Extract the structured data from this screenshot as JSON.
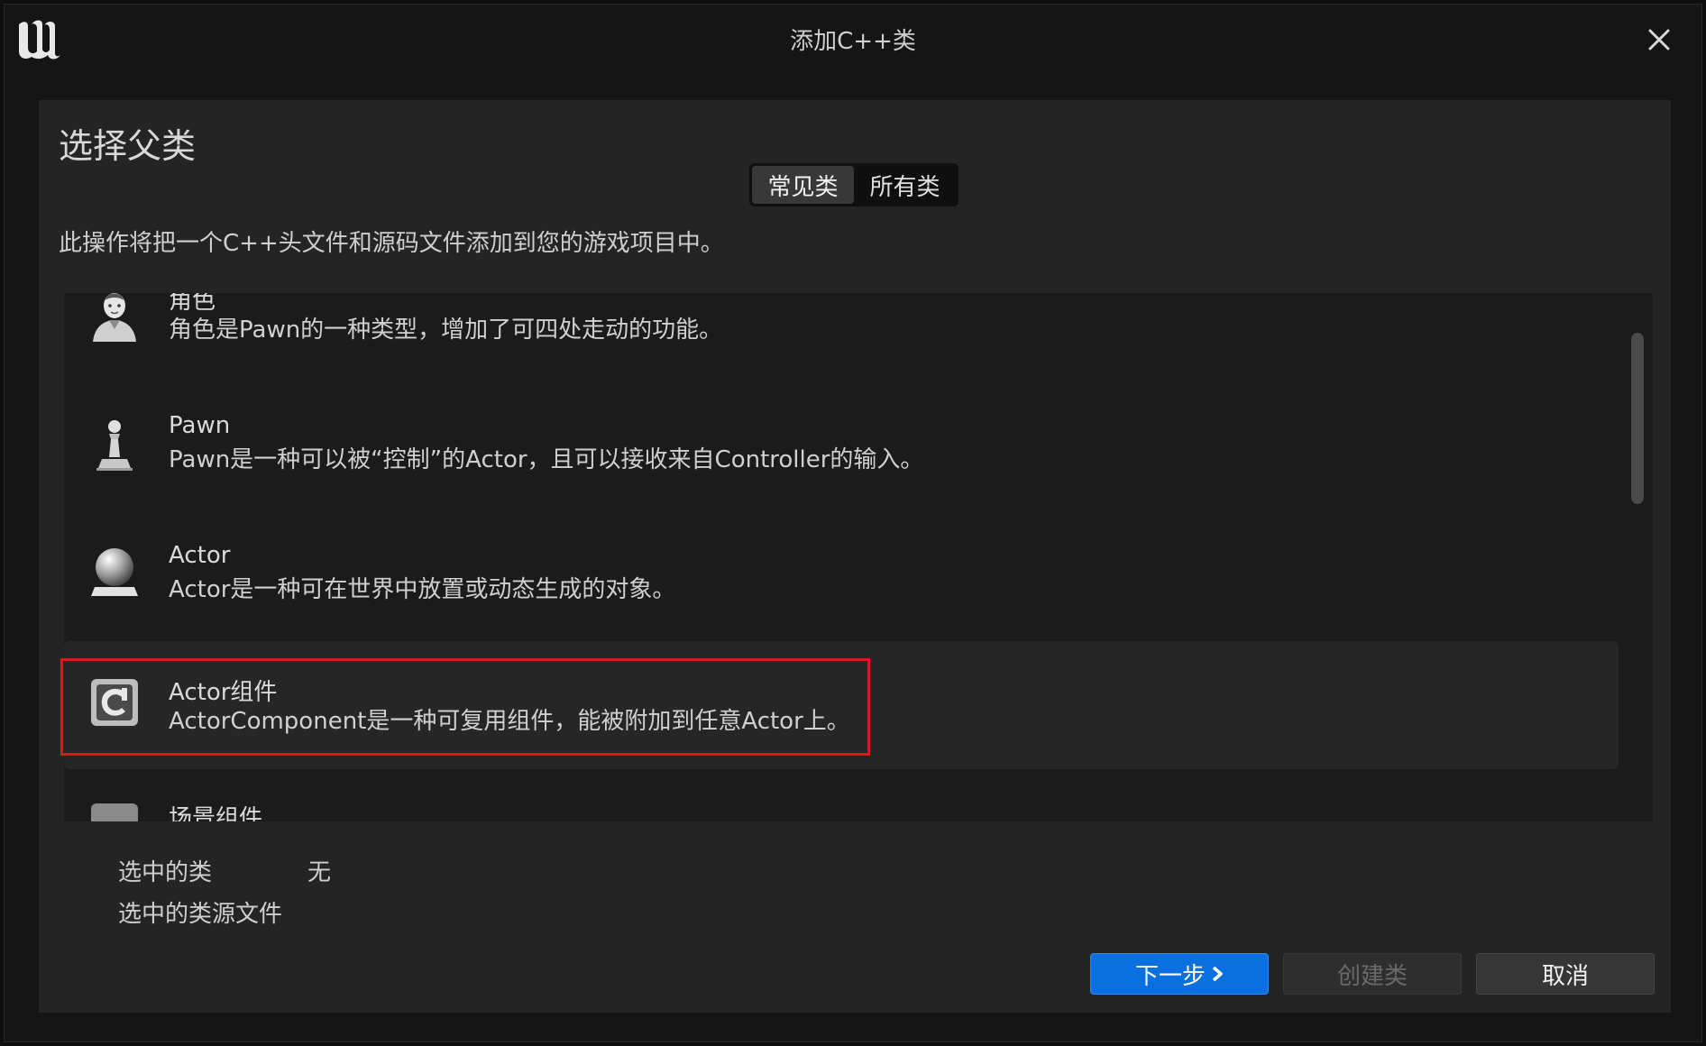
{
  "window": {
    "title": "添加C++类"
  },
  "page": {
    "heading": "选择父类",
    "description": "此操作将把一个C++头文件和源码文件添加到您的游戏项目中。"
  },
  "tabs": [
    {
      "label": "常见类",
      "active": true
    },
    {
      "label": "所有类",
      "active": false
    }
  ],
  "classes": [
    {
      "name": "角色",
      "description": "角色是Pawn的一种类型，增加了可四处走动的功能。",
      "icon": "character-icon"
    },
    {
      "name": "Pawn",
      "description": "Pawn是一种可以被“控制”的Actor，且可以接收来自Controller的输入。",
      "icon": "pawn-icon"
    },
    {
      "name": "Actor",
      "description": "Actor是一种可在世界中放置或动态生成的对象。",
      "icon": "actor-icon"
    },
    {
      "name": "Actor组件",
      "description": "ActorComponent是一种可复用组件，能被附加到任意Actor上。",
      "icon": "actor-component-icon",
      "highlighted": true
    },
    {
      "name": "场景组件",
      "description": "",
      "icon": "scene-component-icon"
    }
  ],
  "selection": {
    "selected_class_label": "选中的类",
    "selected_class_value": "无",
    "source_file_label": "选中的类源文件"
  },
  "buttons": {
    "next": "下一步",
    "create": "创建类",
    "cancel": "取消"
  },
  "colors": {
    "primary_button": "#0a70e0",
    "highlight_border": "#e0161c"
  }
}
